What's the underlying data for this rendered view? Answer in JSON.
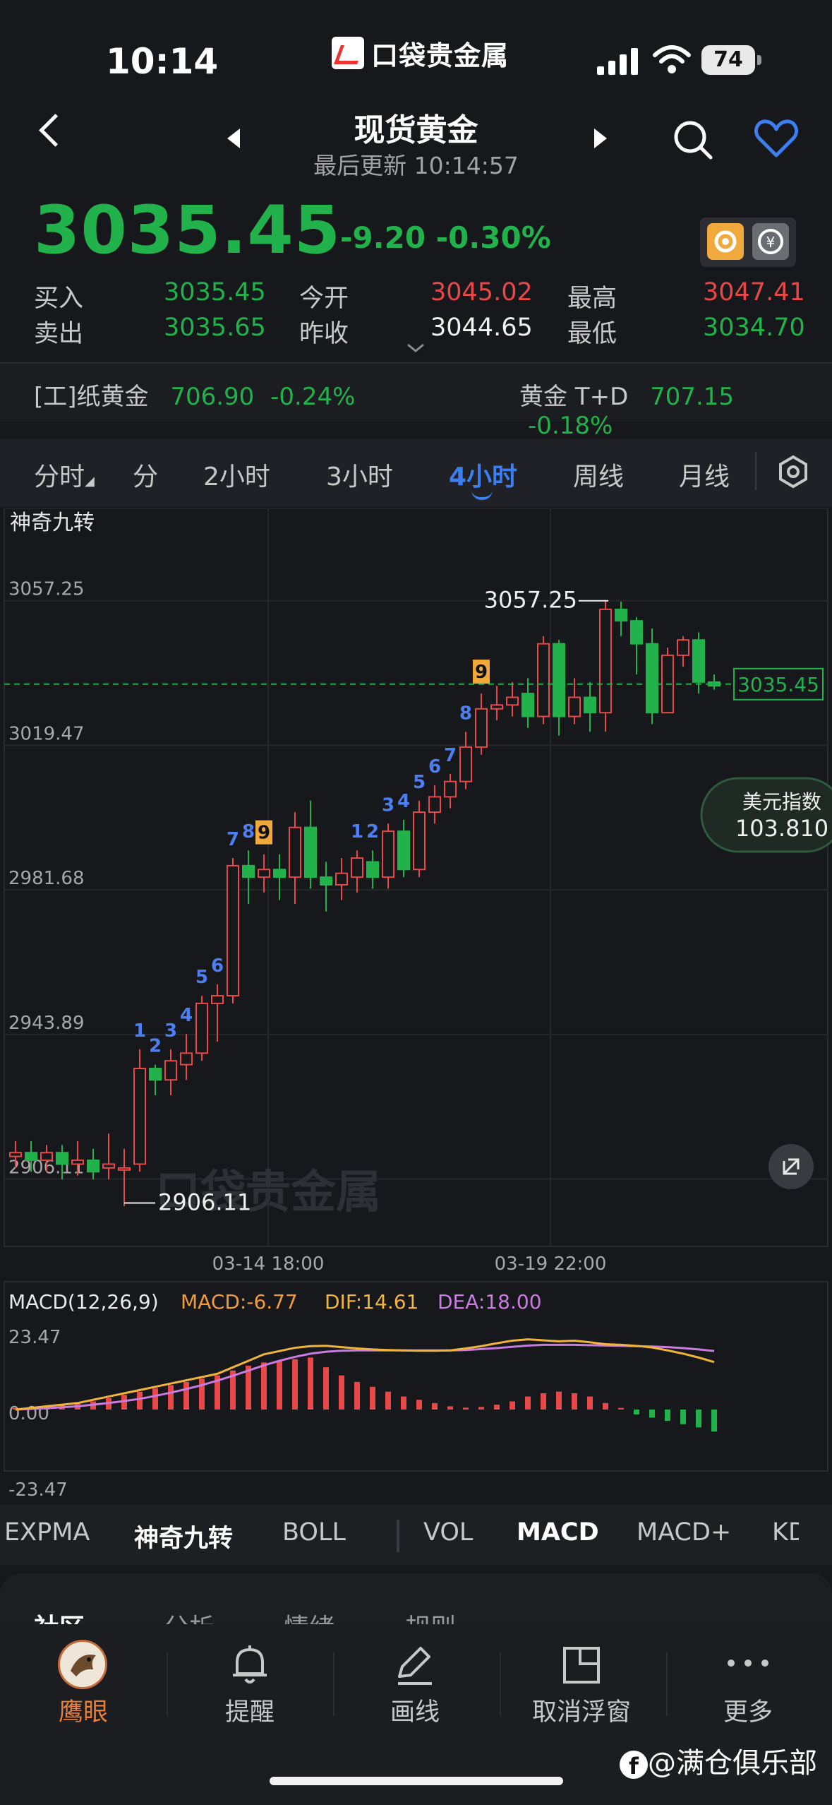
{
  "status": {
    "time": "10:14",
    "battery": "74",
    "app_logo_text": "口袋贵金属"
  },
  "header": {
    "title": "现货黄金",
    "subtitle": "最后更新 10:14:57"
  },
  "quote": {
    "price": "3035.45",
    "change": "-9.20 -0.30%",
    "buy_label": "买入",
    "buy": "3035.45",
    "sell_label": "卖出",
    "sell": "3035.65",
    "open_label": "今开",
    "open": "3045.02",
    "prev_label": "昨收",
    "prev": "3044.65",
    "high_label": "最高",
    "high": "3047.41",
    "low_label": "最低",
    "low": "3034.70"
  },
  "related": [
    {
      "name": "[工]纸黄金",
      "value": "706.90",
      "pct": "-0.24%"
    },
    {
      "name": "黄金 T+D",
      "value": "707.15",
      "pct": "-0.18%"
    }
  ],
  "period_tabs": [
    "分时",
    "分",
    "2小时",
    "3小时",
    "4小时",
    "周线",
    "月线"
  ],
  "active_period": "4小时",
  "chart": {
    "indicator_title": "神奇九转",
    "y_ticks": [
      "3057.25",
      "3019.47",
      "2981.68",
      "2943.89",
      "2906.11"
    ],
    "max_label": "3057.25",
    "min_label": "2906.11",
    "current_label": "3035.45",
    "x_ticks": [
      "03-14 18:00",
      "03-19 22:00"
    ],
    "float_title": "美元指数",
    "float_value": "103.810",
    "watermark": "口袋贵金属"
  },
  "chart_data": {
    "type": "candlestick",
    "ylim": [
      2893.1,
      3070.3
    ],
    "candles": [
      [
        2912,
        2913,
        2916,
        2909
      ],
      [
        2913,
        2911,
        2916,
        2908
      ],
      [
        2911,
        2913,
        2915,
        2908
      ],
      [
        2913,
        2910,
        2915,
        2906
      ],
      [
        2910,
        2911,
        2916,
        2907
      ],
      [
        2911,
        2908,
        2914,
        2906
      ],
      [
        2909,
        2910,
        2918,
        2906
      ],
      [
        2909,
        2909,
        2914,
        2899
      ],
      [
        2910,
        2935,
        2940,
        2908
      ],
      [
        2935,
        2932,
        2936,
        2928
      ],
      [
        2932,
        2937,
        2940,
        2928
      ],
      [
        2936,
        2939,
        2944,
        2932
      ],
      [
        2939,
        2952,
        2954,
        2937
      ],
      [
        2952,
        2954,
        2957,
        2942
      ],
      [
        2954,
        2988,
        2990,
        2952
      ],
      [
        2988,
        2985,
        2992,
        2978
      ],
      [
        2985,
        2987,
        2991,
        2981
      ],
      [
        2987,
        2985,
        2991,
        2979
      ],
      [
        2985,
        2998,
        3002,
        2978
      ],
      [
        2998,
        2985,
        3005,
        2982
      ],
      [
        2985,
        2983,
        2989,
        2976
      ],
      [
        2983,
        2986,
        2990,
        2979
      ],
      [
        2985,
        2990,
        2992,
        2981
      ],
      [
        2989,
        2985,
        2992,
        2982
      ],
      [
        2985,
        2997,
        2999,
        2982
      ],
      [
        2997,
        2987,
        3000,
        2985
      ],
      [
        2987,
        3002,
        3005,
        2985
      ],
      [
        3002,
        3006,
        3009,
        2999
      ],
      [
        3006,
        3010,
        3012,
        3003
      ],
      [
        3010,
        3019,
        3023,
        3008
      ],
      [
        3019,
        3029,
        3033,
        3017
      ],
      [
        3029,
        3030,
        3035,
        3026
      ],
      [
        3030,
        3032,
        3036,
        3027
      ],
      [
        3033,
        3027,
        3037,
        3024
      ],
      [
        3027,
        3046,
        3048,
        3025
      ],
      [
        3046,
        3027,
        3047,
        3022
      ],
      [
        3027,
        3032,
        3037,
        3025
      ],
      [
        3032,
        3028,
        3036,
        3023
      ],
      [
        3028,
        3055,
        3057,
        3023
      ],
      [
        3055,
        3052,
        3057,
        3048
      ],
      [
        3052,
        3046,
        3053,
        3038
      ],
      [
        3046,
        3028,
        3050,
        3025
      ],
      [
        3028,
        3043,
        3045,
        3028
      ],
      [
        3043,
        3047,
        3048,
        3040
      ],
      [
        3047,
        3036,
        3049,
        3033
      ],
      [
        3036,
        3035,
        3038,
        3034
      ]
    ],
    "td_counts": [
      {
        "index": 8,
        "label": "1"
      },
      {
        "index": 9,
        "label": "2"
      },
      {
        "index": 10,
        "label": "3"
      },
      {
        "index": 11,
        "label": "4"
      },
      {
        "index": 12,
        "label": "5"
      },
      {
        "index": 13,
        "label": "6"
      },
      {
        "index": 14,
        "label": "7"
      },
      {
        "index": 15,
        "label": "8"
      },
      {
        "index": 16,
        "label": "9",
        "highlight": true
      },
      {
        "index": 22,
        "label": "1"
      },
      {
        "index": 23,
        "label": "2"
      },
      {
        "index": 24,
        "label": "3"
      },
      {
        "index": 25,
        "label": "4"
      },
      {
        "index": 26,
        "label": "5"
      },
      {
        "index": 27,
        "label": "6"
      },
      {
        "index": 28,
        "label": "7"
      },
      {
        "index": 29,
        "label": "8"
      },
      {
        "index": 30,
        "label": "9",
        "highlight": true
      }
    ],
    "macd": {
      "title": "MACD(12,26,9)",
      "macd_label": "MACD:-6.77",
      "dif_label": "DIF:14.61",
      "dea_label": "DEA:18.00",
      "y_ticks": [
        "23.47",
        "0.00",
        "-23.47"
      ],
      "ylim": [
        -23.47,
        23.47
      ],
      "hist": [
        0.5,
        0.8,
        1.2,
        1.5,
        1.8,
        2.5,
        3.5,
        4.5,
        5.5,
        6.5,
        7.5,
        8.5,
        9.5,
        10.5,
        12,
        13.5,
        14.5,
        15,
        15.5,
        16,
        13,
        10.5,
        8.5,
        7,
        5.5,
        4,
        3,
        2,
        1,
        0.6,
        0.8,
        1.5,
        2.5,
        4,
        5,
        5.5,
        5,
        4,
        2,
        0.5,
        -1.5,
        -2.5,
        -3.5,
        -4.5,
        -5.5,
        -6.77
      ],
      "dif": [
        0,
        0.5,
        1,
        1.5,
        2,
        3,
        4,
        5,
        6,
        7,
        8,
        9,
        10,
        11,
        13,
        15,
        17,
        18,
        19,
        19.5,
        19.6,
        19.2,
        18.8,
        18.5,
        18.3,
        18.2,
        18.1,
        18.1,
        18.2,
        18.8,
        19.5,
        20.4,
        21.2,
        21.6,
        21.3,
        21,
        21.2,
        20.7,
        20.1,
        19.9,
        19.6,
        19.1,
        18.2,
        17.2,
        16,
        14.61
      ],
      "dea": [
        0,
        0.2,
        0.4,
        0.7,
        1,
        1.5,
        2,
        2.6,
        3.3,
        4.2,
        5.2,
        6.3,
        7.5,
        8.9,
        10.4,
        12,
        13.6,
        15,
        16.2,
        17.2,
        17.8,
        18.1,
        18.2,
        18.2,
        18.2,
        18.2,
        18.2,
        18.2,
        18.2,
        18.3,
        18.6,
        18.9,
        19.3,
        19.7,
        19.9,
        19.9,
        19.9,
        19.8,
        19.7,
        19.6,
        19.5,
        19.4,
        19.2,
        18.9,
        18.5,
        18.0
      ]
    }
  },
  "indicator_tabs": [
    "EXPMA",
    "神奇九转",
    "BOLL",
    "VOL",
    "MACD",
    "MACD+",
    "KD"
  ],
  "active_indicators": [
    "神奇九转",
    "MACD"
  ],
  "sheet_tabs": [
    "社区",
    "分析",
    "情绪",
    "规则"
  ],
  "toolbar": [
    {
      "label": "鹰眼",
      "icon": "eagle-avatar-icon"
    },
    {
      "label": "提醒",
      "icon": "bell-icon"
    },
    {
      "label": "画线",
      "icon": "pencil-icon"
    },
    {
      "label": "取消浮窗",
      "icon": "floating-window-icon"
    },
    {
      "label": "更多",
      "icon": "more-dots-icon"
    }
  ],
  "overlay_credit": "@满仓俱乐部",
  "colors": {
    "up": "#e84848",
    "down": "#22b24c",
    "accent": "#3d7ef0",
    "bg": "#17181b"
  }
}
